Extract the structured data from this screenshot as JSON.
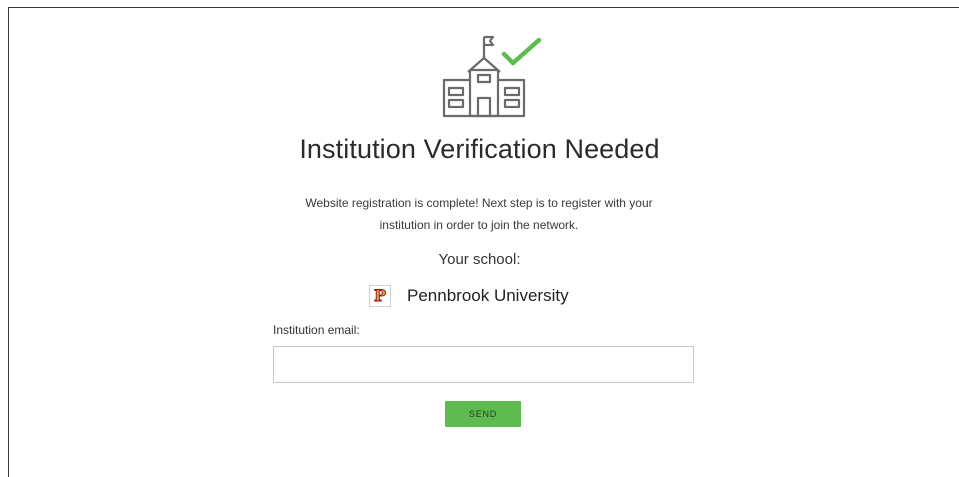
{
  "illustration": {
    "icon": "school-building-icon",
    "check_icon": "checkmark-icon",
    "building_color": "#6b6b6b",
    "check_color": "#5dbb4f"
  },
  "title": "Institution Verification Needed",
  "description": "Website registration is complete! Next step is to register with your institution in order to join the network.",
  "school": {
    "label": "Your school:",
    "logo_letter": "P",
    "name": "Pennbrook University"
  },
  "email": {
    "label": "Institution email:",
    "value": "",
    "placeholder": ""
  },
  "send_button": {
    "label": "SEND",
    "color": "#5dbb4f"
  }
}
